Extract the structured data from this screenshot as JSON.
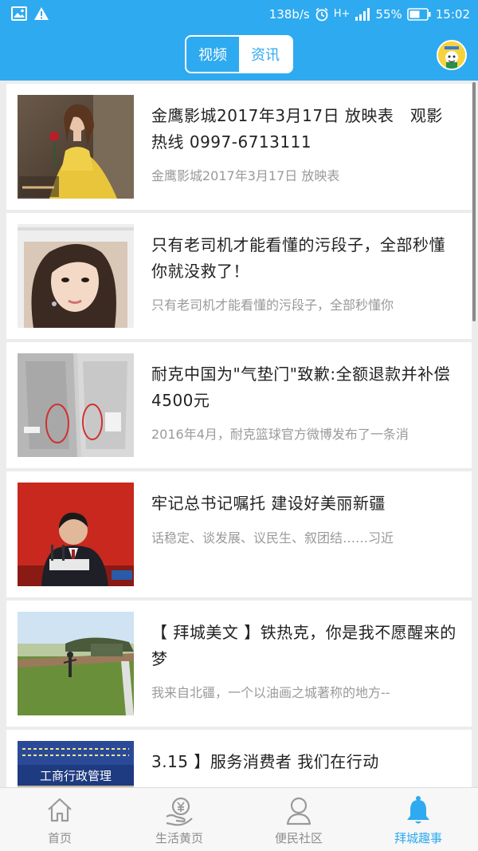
{
  "status_bar": {
    "network_speed": "138b/s",
    "network_type": "H+",
    "battery": "55%",
    "time": "15:02",
    "icons": [
      "image-icon",
      "warning-icon",
      "alarm-icon",
      "signal-icon",
      "battery-icon"
    ]
  },
  "header": {
    "tabs": [
      {
        "label": "视频",
        "active": false
      },
      {
        "label": "资讯",
        "active": true
      }
    ],
    "accent_color": "#2eaaf0"
  },
  "feed": [
    {
      "title": "金鹰影城2017年3月17日 放映表　观影热线 0997-6713111",
      "desc": "金鹰影城2017年3月17日 放映表",
      "image": "movie-poster-thumbnail"
    },
    {
      "title": "只有老司机才能看懂的污段子，全部秒懂你就没救了！",
      "desc": "只有老司机才能看懂的污段子，全部秒懂你",
      "image": "portrait-thumbnail"
    },
    {
      "title": "耐克中国为\"气垫门\"致歉:全额退款并补偿4500元",
      "desc": "2016年4月，耐克篮球官方微博发布了一条消",
      "image": "sneaker-thumbnail"
    },
    {
      "title": "牢记总书记嘱托 建设好美丽新疆",
      "desc": "话稳定、谈发展、议民生、叙团结……习近",
      "image": "meeting-thumbnail"
    },
    {
      "title": "【 拜城美文 】铁热克，你是我不愿醒来的梦",
      "desc": "我来自北疆，一个以油画之城著称的地方--",
      "image": "landscape-thumbnail"
    },
    {
      "title": "3.15 】服务消费者 我们在行动",
      "desc": "",
      "image": "event-banner-thumbnail",
      "banner_text": "工商行政管理"
    }
  ],
  "bottom_nav": [
    {
      "label": "首页",
      "icon": "home-icon",
      "active": false
    },
    {
      "label": "生活黄页",
      "icon": "yen-hand-icon",
      "active": false
    },
    {
      "label": "便民社区",
      "icon": "person-icon",
      "active": false
    },
    {
      "label": "拜城趣事",
      "icon": "bell-icon",
      "active": true
    }
  ]
}
